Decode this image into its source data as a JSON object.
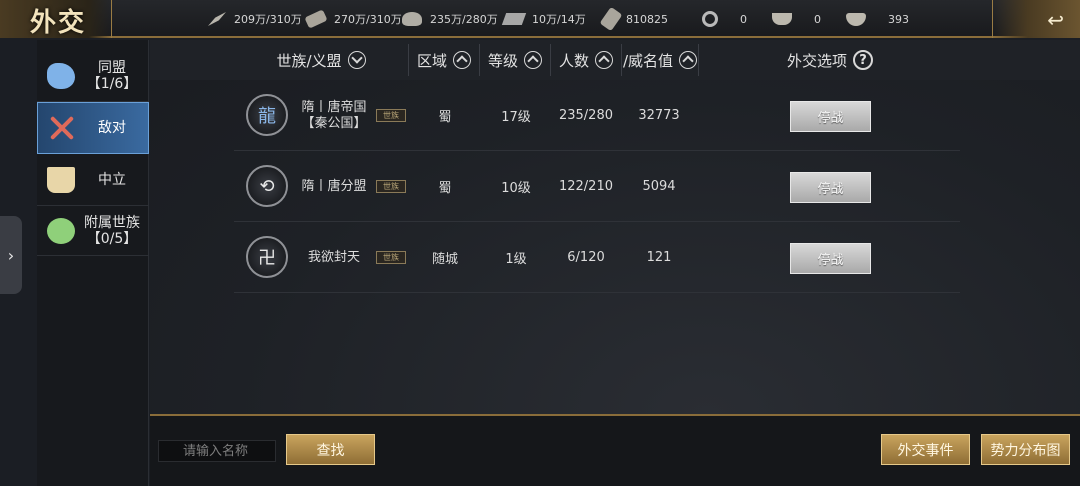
{
  "title": "外交",
  "resources": [
    {
      "icon": "grain-icon",
      "value": "209万/310万"
    },
    {
      "icon": "wood-icon",
      "value": "270万/310万"
    },
    {
      "icon": "stone-icon",
      "value": "235万/280万"
    },
    {
      "icon": "iron-icon",
      "value": "10万/14万"
    },
    {
      "icon": "decree-icon",
      "value": "810825"
    },
    {
      "icon": "copper-coin-icon",
      "value": "0"
    },
    {
      "icon": "gold-ingot-icon",
      "value": "0"
    },
    {
      "icon": "jade-bowl-icon",
      "value": "393"
    }
  ],
  "sidebar": {
    "items": [
      {
        "label": "同盟\n【1/6】",
        "icon": "ally-icon"
      },
      {
        "label": "敌对",
        "icon": "crossed-swords-icon",
        "active": true
      },
      {
        "label": "中立",
        "icon": "neutral-banner-icon"
      },
      {
        "label": "附属世族\n【0/5】",
        "icon": "vassal-icon"
      }
    ],
    "expand_glyph": "›"
  },
  "table": {
    "headers": [
      "世族/义盟",
      "区域",
      "等级",
      "人数",
      "/威名值",
      "外交选项"
    ],
    "help_glyph": "?",
    "rows": [
      {
        "emblem": "龍",
        "name": "隋丨唐帝国\n【秦公国】",
        "tag": "世族",
        "region": "蜀",
        "level": "17级",
        "members": "235/280",
        "prestige": "32773",
        "action": "停战"
      },
      {
        "emblem": "⟲",
        "name": "隋丨唐分盟",
        "tag": "世族",
        "region": "蜀",
        "level": "10级",
        "members": "122/210",
        "prestige": "5094",
        "action": "停战"
      },
      {
        "emblem": "卍",
        "name": "我欲封天",
        "tag": "世族",
        "region": "随城",
        "level": "1级",
        "members": "6/120",
        "prestige": "121",
        "action": "停战"
      }
    ]
  },
  "bottom": {
    "search_placeholder": "请输入名称",
    "search_button": "查找",
    "events_button": "外交事件",
    "map_button": "势力分布图"
  },
  "back_glyph": "↩"
}
